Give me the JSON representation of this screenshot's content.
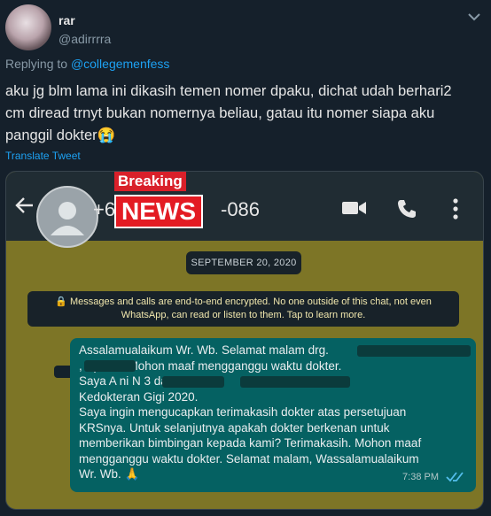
{
  "tweet": {
    "display_name": "rar",
    "handle": "@adirrrra",
    "replying_prefix": "Replying to ",
    "replying_to": "@collegemenfess",
    "text": "aku jg blm lama ini dikasih temen nomer dpaku, dichat udah berhari2 cm diread trnyt bukan nomernya beliau, gatau itu nomer siapa aku panggil dokter😭",
    "translate_label": "Translate Tweet"
  },
  "whatsapp": {
    "contact_prefix": "+6",
    "contact_suffix": "-086",
    "overlay_breaking": "Breaking",
    "overlay_news": "NEWS",
    "date_chip": "SEPTEMBER 20, 2020",
    "encryption_notice": "Messages and calls are end-to-end encrypted. No one outside of this chat, not even WhatsApp, can read or listen to them. Tap to learn more.",
    "message": {
      "lines": [
        "Assalamualaikum Wr. Wb. Selamat malam drg.",
        ", Sp.PM. Mohon maaf mengganggu waktu dokter.",
        "Saya A                         ni N                                3 dari Fakultas",
        "Kedokteran Gigi 2020.",
        "Saya ingin mengucapkan terimakasih dokter atas persetujuan",
        "KRSnya. Untuk selanjutnya apakah dokter berkenan untuk",
        "memberikan bimbingan kepada kami? Terimakasih. Mohon maaf",
        "mengganggu waktu dokter. Selamat malam, Wassalamualaikum",
        "Wr. Wb. 🙏"
      ],
      "time": "7:38 PM"
    }
  },
  "icons": {
    "more": "more-chevron-icon",
    "back": "back-arrow-icon",
    "video": "video-call-icon",
    "phone": "voice-call-icon",
    "menu": "kebab-menu-icon",
    "lock": "lock-icon",
    "read": "double-check-icon"
  },
  "colors": {
    "background": "#15202b",
    "accent": "#1da1f2",
    "wa_header": "#202c33",
    "wa_bubble": "#056162",
    "wa_chat_bg": "#7d7526",
    "news_red": "#e31b23"
  }
}
